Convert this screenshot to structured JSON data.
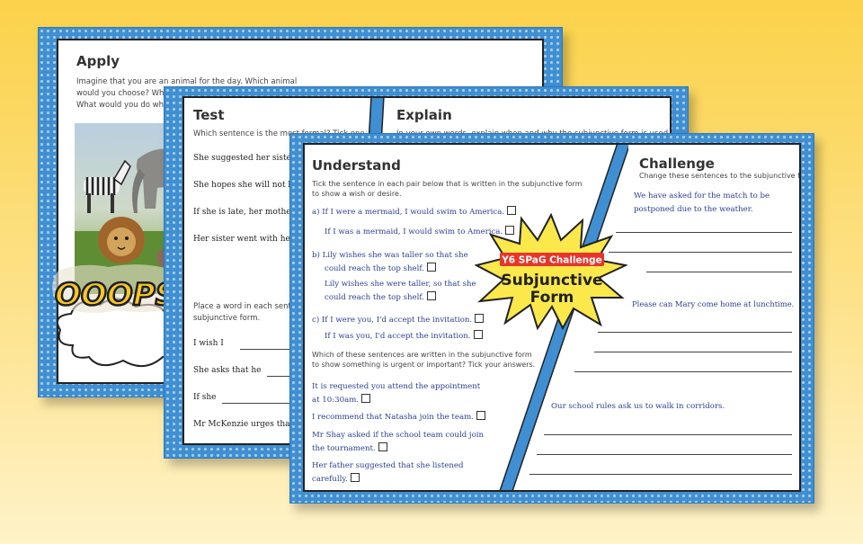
{
  "apply": {
    "title": "Apply",
    "prompt_line1": "Imagine that you are an animal for the day. Which animal",
    "prompt_line2": "would you choose? Why?",
    "prompt_line3": "What would you do whi",
    "ooops": "OOOPS"
  },
  "test": {
    "title": "Test",
    "question1": "Which sentence is the most formal? Tick one.",
    "options": [
      "She suggested her siste",
      "She hopes she will not b",
      "If she is late, her mothe",
      "Her sister went with he"
    ],
    "question2_line1": "Place a word in each sentence",
    "question2_line2": "subjunctive form.",
    "fill": [
      "I wish I",
      "She asks that he",
      "If she",
      "Mr McKenzie urges tha"
    ]
  },
  "explain": {
    "title": "Explain",
    "prompt": "In your own words, explain when and why the subjunctive form is used."
  },
  "understand": {
    "title": "Understand",
    "instr_line1": "Tick the sentence in each pair below that is written in the subjunctive form",
    "instr_line2": "to show a wish or desire.",
    "a1": "a)  If I were a mermaid, I would swim to America.",
    "a2": "If I was a mermaid, I would swim to America.",
    "b1_line1": "b)  Lily wishes she was taller so that she",
    "b1_line2": "could reach the top shelf.",
    "b2_line1": "Lily wishes she were taller, so that she",
    "b2_line2": "could reach the top shelf.",
    "c1": "c)  If I were you, I'd accept the invitation.",
    "c2": "If I was you, I'd accept the invitation.",
    "instr2_line1": "Which of these sentences are written in the subjunctive form",
    "instr2_line2": "to show something is urgent or important? Tick your answers.",
    "d1_line1": "It is requested you attend the appointment",
    "d1_line2": "at 10:30am.",
    "d2": "I recommend that Natasha join the team.",
    "d3_line1": "Mr Shay asked if the school team could join",
    "d3_line2": "the tournament.",
    "d4_line1": "Her father suggested that she listened",
    "d4_line2": "carefully."
  },
  "challenge": {
    "title": "Challenge",
    "instr": "Change these sentences to the subjunctive form.",
    "s1_line1": "We have asked for the match to be",
    "s1_line2": "postponed due to the weather.",
    "s2": "Please can Mary come home at lunchtime.",
    "s3": "Our school rules ask us to walk in corridors."
  },
  "badge": {
    "top": "Y6 SPaG Challenge",
    "line1": "Subjunctive",
    "line2": "Form"
  },
  "colors": {
    "border_blue": "#3f8fd2",
    "badge_yellow": "#fbe84a",
    "badge_red": "#e8352b",
    "text_blue": "#2b3f92"
  }
}
